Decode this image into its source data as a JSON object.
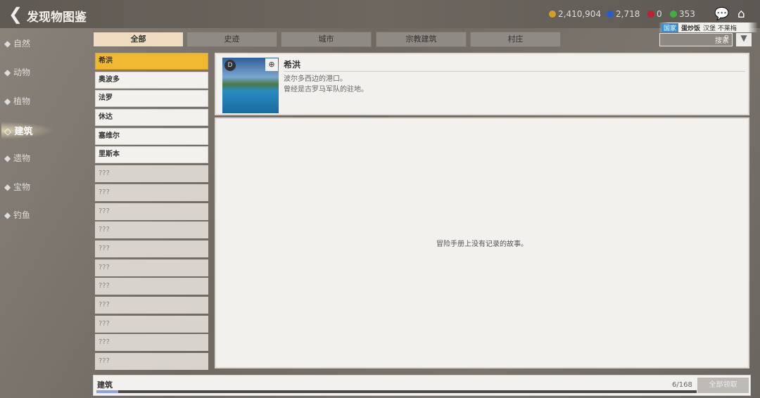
{
  "header": {
    "title": "发现物图鉴",
    "resources": [
      {
        "name": "gold",
        "value": "2,410,904",
        "color": "#d4a020"
      },
      {
        "name": "gem",
        "value": "2,718",
        "color": "#2a5cd0"
      },
      {
        "name": "ruby",
        "value": "0",
        "color": "#c02030"
      },
      {
        "name": "energy",
        "value": "353",
        "color": "#40b040"
      }
    ],
    "server": {
      "tag": "国家",
      "name": "蛋炒饭",
      "extra": "汉堡 不莱梅"
    }
  },
  "sidebar": [
    "自然",
    "动物",
    "植物",
    "建筑",
    "遗物",
    "宝物",
    "钓鱼"
  ],
  "sidebar_active": 3,
  "tabs": [
    "全部",
    "史迹",
    "城市",
    "宗教建筑",
    "村庄"
  ],
  "search": {
    "placeholder": "搜索"
  },
  "list": [
    "希洪",
    "奥波多",
    "法罗",
    "休达",
    "塞维尔",
    "里斯本",
    "???",
    "???",
    "???",
    "???",
    "???",
    "???",
    "???",
    "???",
    "???",
    "???",
    "???"
  ],
  "detail": {
    "name": "希洪",
    "desc1": "波尔多西边的港口。",
    "desc2": "曾经是古罗马军队的驻地。",
    "story": "冒险手册上没有记录的故事。"
  },
  "footer": {
    "label": "建筑",
    "count": "6/168",
    "progress": 0.036,
    "claim": "全部领取"
  }
}
